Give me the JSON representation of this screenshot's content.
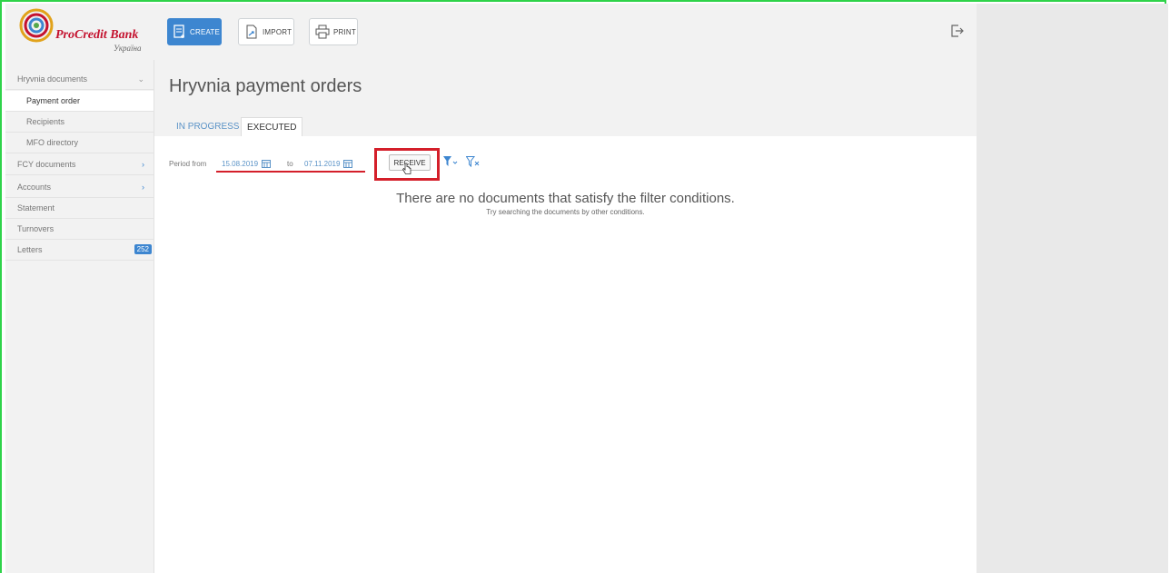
{
  "brand": {
    "name": "ProCredit Bank",
    "sub": "Україна"
  },
  "toolbar": {
    "create_label": "CREATE",
    "import_label": "IMPORT",
    "print_label": "PRINT"
  },
  "sidebar": {
    "items": [
      {
        "label": "Hryvnia documents"
      },
      {
        "label": "Payment order"
      },
      {
        "label": "Recipients"
      },
      {
        "label": "MFO directory"
      },
      {
        "label": "FCY documents"
      },
      {
        "label": "Accounts"
      },
      {
        "label": "Statement"
      },
      {
        "label": "Turnovers"
      },
      {
        "label": "Letters",
        "badge": "252"
      }
    ]
  },
  "main": {
    "title": "Hryvnia payment orders",
    "tabs": [
      {
        "label": "IN PROGRESS"
      },
      {
        "label": "EXECUTED"
      }
    ]
  },
  "filter": {
    "period_label": "Period from",
    "from_date": "15.08.2019",
    "to_label": "to",
    "to_date": "07.11.2019",
    "receive_label": "RECEIVE"
  },
  "empty": {
    "title": "There are no documents that satisfy the filter conditions.",
    "subtitle": "Try searching the documents by other conditions."
  },
  "colors": {
    "accent": "#3d86d0",
    "brand_red": "#c4122f",
    "highlight": "#d41f2a"
  }
}
